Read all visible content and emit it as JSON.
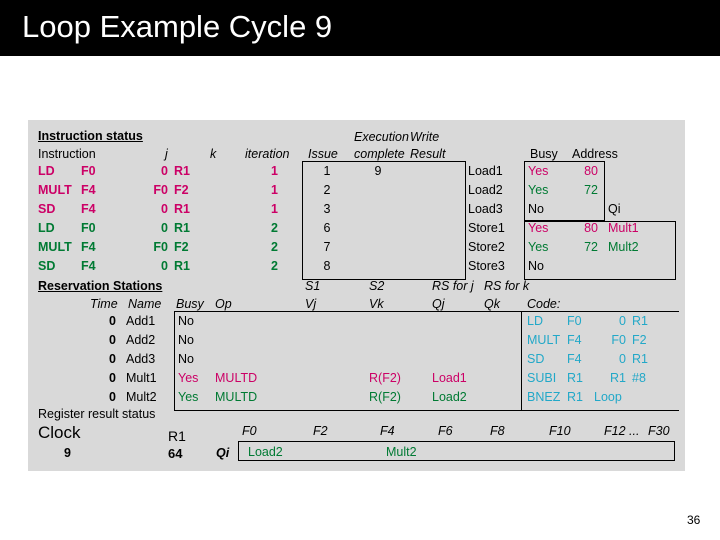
{
  "slide": {
    "title": "Loop Example Cycle 9",
    "page_number": "36",
    "colors": {
      "title_bar_bg": "#000000",
      "title_text": "#ffffff",
      "panel_bg": "#d9d9d9",
      "iteration1": "#cc0066",
      "iteration2": "#007a33",
      "code": "#22a8c8"
    }
  },
  "instruction_status": {
    "section_label": "Instruction status",
    "headers": {
      "instruction": "Instruction",
      "j": "j",
      "k": "k",
      "iteration": "iteration",
      "issue": "Issue",
      "execution": "Execution",
      "complete": "complete",
      "write": "Write",
      "result": "Result"
    },
    "rows": [
      {
        "op": "LD",
        "dest": "F0",
        "j": "0",
        "k": "R1",
        "iteration": "1",
        "issue": "1",
        "exec_complete": "9",
        "write_result": "",
        "color": "pink"
      },
      {
        "op": "MULT",
        "dest": "F4",
        "j": "F0",
        "k": "F2",
        "iteration": "1",
        "issue": "2",
        "exec_complete": "",
        "write_result": "",
        "color": "pink"
      },
      {
        "op": "SD",
        "dest": "F4",
        "j": "0",
        "k": "R1",
        "iteration": "1",
        "issue": "3",
        "exec_complete": "",
        "write_result": "",
        "color": "pink"
      },
      {
        "op": "LD",
        "dest": "F0",
        "j": "0",
        "k": "R1",
        "iteration": "2",
        "issue": "6",
        "exec_complete": "",
        "write_result": "",
        "color": "green"
      },
      {
        "op": "MULT",
        "dest": "F4",
        "j": "F0",
        "k": "F2",
        "iteration": "2",
        "issue": "7",
        "exec_complete": "",
        "write_result": "",
        "color": "green"
      },
      {
        "op": "SD",
        "dest": "F4",
        "j": "0",
        "k": "R1",
        "iteration": "2",
        "issue": "8",
        "exec_complete": "",
        "write_result": "",
        "color": "green"
      }
    ]
  },
  "memory_units": {
    "headers": {
      "busy": "Busy",
      "address": "Address",
      "qi": "Qi"
    },
    "rows": [
      {
        "name": "Load1",
        "busy": "Yes",
        "address": "80",
        "qi": "",
        "color": "pink"
      },
      {
        "name": "Load2",
        "busy": "Yes",
        "address": "72",
        "qi": "",
        "color": "green"
      },
      {
        "name": "Load3",
        "busy": "No",
        "address": "",
        "qi": "",
        "color": "black"
      },
      {
        "name": "Store1",
        "busy": "Yes",
        "address": "80",
        "qi": "Mult1",
        "color": "pink"
      },
      {
        "name": "Store2",
        "busy": "Yes",
        "address": "72",
        "qi": "Mult2",
        "color": "green"
      },
      {
        "name": "Store3",
        "busy": "No",
        "address": "",
        "qi": "",
        "color": "black"
      }
    ]
  },
  "reservation_stations": {
    "section_label": "Reservation Stations",
    "headers": {
      "time": "Time",
      "name": "Name",
      "busy": "Busy",
      "op": "Op",
      "s1": "S1",
      "vj": "Vj",
      "s2": "S2",
      "vk": "Vk",
      "rs_for_j": "RS for j",
      "qj": "Qj",
      "rs_for_k": "RS for k",
      "qk": "Qk"
    },
    "rows": [
      {
        "time": "0",
        "name": "Add1",
        "busy": "No",
        "op": "",
        "vj": "",
        "vk": "",
        "qj": "",
        "qk": "",
        "color": "black"
      },
      {
        "time": "0",
        "name": "Add2",
        "busy": "No",
        "op": "",
        "vj": "",
        "vk": "",
        "qj": "",
        "qk": "",
        "color": "black"
      },
      {
        "time": "0",
        "name": "Add3",
        "busy": "No",
        "op": "",
        "vj": "",
        "vk": "",
        "qj": "",
        "qk": "",
        "color": "black"
      },
      {
        "time": "0",
        "name": "Mult1",
        "busy": "Yes",
        "op": "MULTD",
        "vj": "",
        "vk": "R(F2)",
        "qj": "Load1",
        "qk": "",
        "color": "pink"
      },
      {
        "time": "0",
        "name": "Mult2",
        "busy": "Yes",
        "op": "MULTD",
        "vj": "",
        "vk": "R(F2)",
        "qj": "Load2",
        "qk": "",
        "color": "green"
      }
    ]
  },
  "code": {
    "label": "Code:",
    "lines": [
      {
        "op": "LD",
        "a": "F0",
        "b": "0",
        "c": "R1"
      },
      {
        "op": "MULT",
        "a": "F4",
        "b": "F0",
        "c": "F2"
      },
      {
        "op": "SD",
        "a": "F4",
        "b": "0",
        "c": "R1"
      },
      {
        "op": "SUBI",
        "a": "R1",
        "b": "R1",
        "c": "#8"
      },
      {
        "op": "BNEZ",
        "a": "R1",
        "b": "Loop",
        "c": ""
      }
    ]
  },
  "register_result_status": {
    "section_label": "Register result status",
    "clock_label": "Clock",
    "clock_value": "9",
    "r1_label": "R1",
    "r1_value": "64",
    "qi_label": "Qi",
    "registers": [
      "F0",
      "F2",
      "F4",
      "F6",
      "F8",
      "F10",
      "F12 ...",
      "F30"
    ],
    "values": [
      {
        "reg": "F0",
        "value": "Load2",
        "color": "green"
      },
      {
        "reg": "F2",
        "value": "",
        "color": "black"
      },
      {
        "reg": "F4",
        "value": "Mult2",
        "color": "green"
      },
      {
        "reg": "F6",
        "value": "",
        "color": "black"
      },
      {
        "reg": "F8",
        "value": "",
        "color": "black"
      },
      {
        "reg": "F10",
        "value": "",
        "color": "black"
      },
      {
        "reg": "F12 ...",
        "value": "",
        "color": "black"
      },
      {
        "reg": "F30",
        "value": "",
        "color": "black"
      }
    ]
  }
}
